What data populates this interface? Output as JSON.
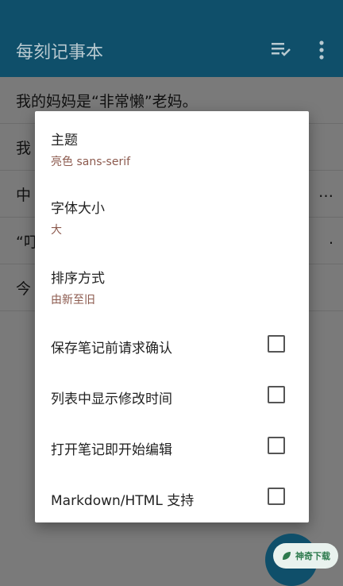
{
  "appbar": {
    "title": "每刻记事本",
    "sort_icon": "checklist-sort-icon",
    "menu_icon": "more-vert-icon"
  },
  "notes": [
    {
      "text": "我的妈妈是“非常懒”老妈。",
      "ellipsis": ""
    },
    {
      "text": "我",
      "ellipsis": ""
    },
    {
      "text": "中",
      "ellipsis": "…"
    },
    {
      "text": "“叮",
      "ellipsis": "."
    },
    {
      "text": "今",
      "ellipsis": ""
    }
  ],
  "dialog": {
    "theme": {
      "title": "主题",
      "summary": "亮色 sans-serif"
    },
    "font_size": {
      "title": "字体大小",
      "summary": "大"
    },
    "sort": {
      "title": "排序方式",
      "summary": "由新至旧"
    },
    "options": [
      {
        "label": "保存笔记前请求确认",
        "checked": false
      },
      {
        "label": "列表中显示修改时间",
        "checked": false
      },
      {
        "label": "打开笔记即开始编辑",
        "checked": false
      },
      {
        "label": "Markdown/HTML 支持",
        "checked": false
      }
    ]
  },
  "watermark": {
    "text": "神奇下载"
  },
  "colors": {
    "primary": "#0f4f6a",
    "summary_text": "#8c5a4e",
    "scrim": "#7a7a7a"
  }
}
